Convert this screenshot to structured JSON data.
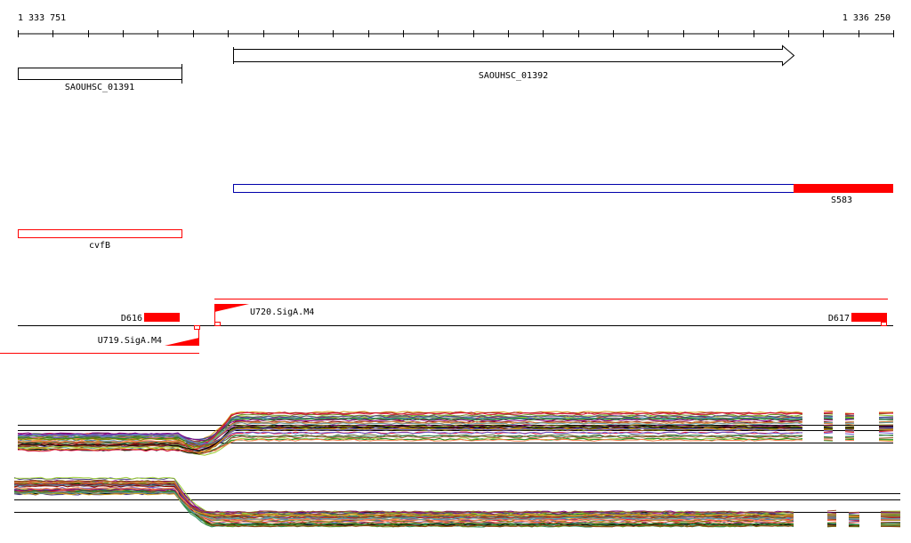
{
  "ruler": {
    "start_label": "1 333 751",
    "end_label": "1 336 250"
  },
  "genes": [
    {
      "label": "SAOUHSC_01391"
    },
    {
      "label": "SAOUHSC_01392"
    }
  ],
  "features": {
    "transcript": {
      "label": "S583"
    },
    "rna": {
      "label": "cvfB"
    },
    "segments": [
      {
        "label": "D616"
      },
      {
        "label": "U720.SigA.M4"
      },
      {
        "label": "D617"
      },
      {
        "label": "U719.SigA.M4"
      }
    ]
  },
  "colors": {
    "feature_red": "#ff0000",
    "transcript_blue": "#0000aa",
    "axis": "#000000"
  }
}
